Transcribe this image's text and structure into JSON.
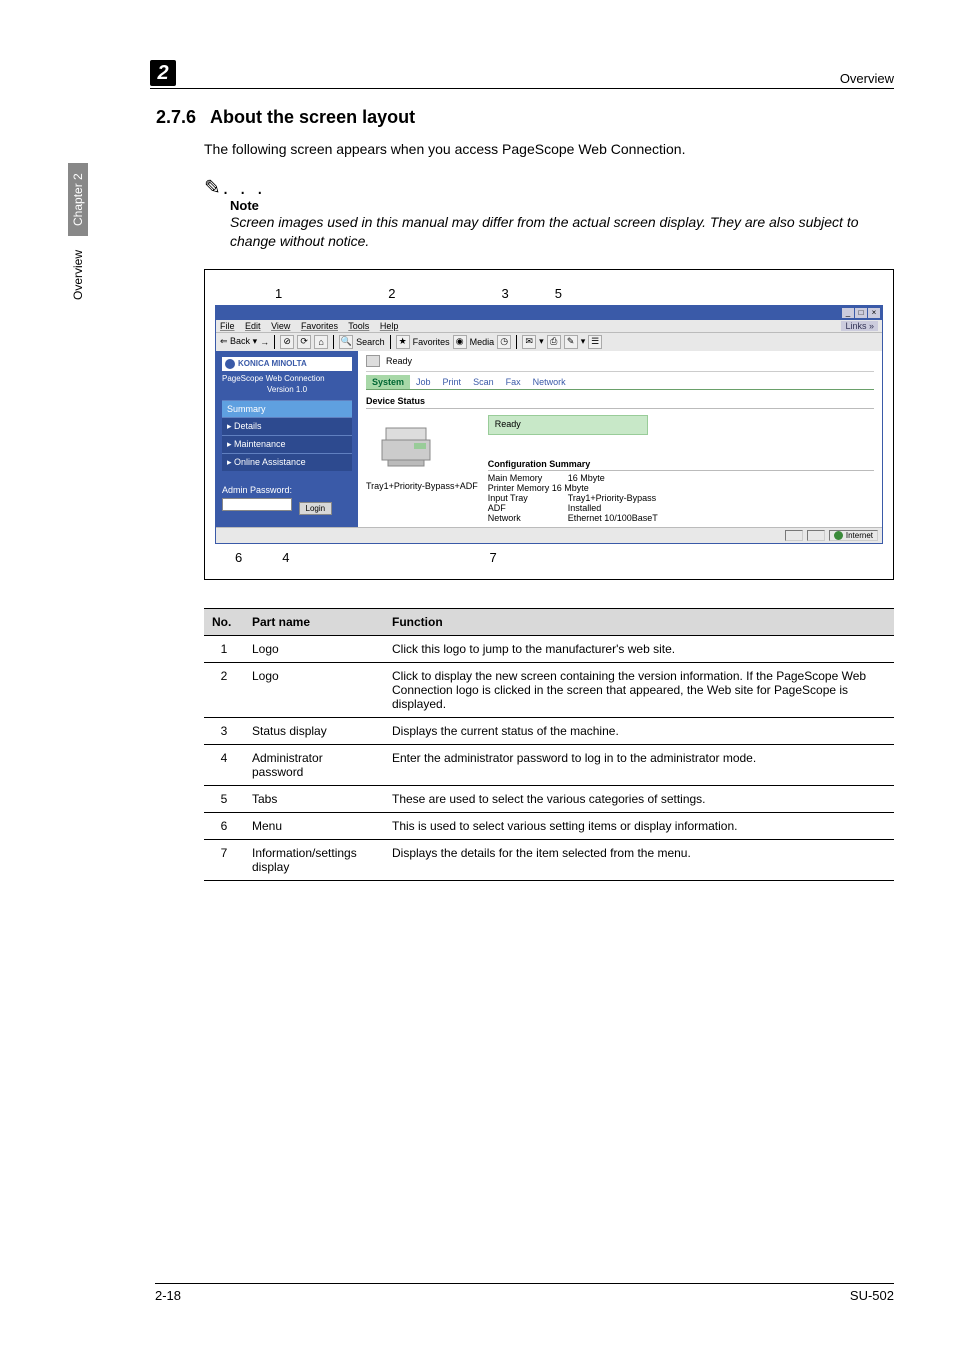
{
  "header": {
    "topic": "Overview",
    "chapter_badge": "2"
  },
  "side_tab": {
    "label": "Overview",
    "chapter": "Chapter 2"
  },
  "section": {
    "number": "2.7.6",
    "title": "About the screen layout"
  },
  "intro": "The following screen appears when you access PageScope Web Connection.",
  "note": {
    "icon": "✎",
    "dots": ". . .",
    "label": "Note",
    "text": "Screen images used in this manual may differ from the actual screen display. They are also subject to change without notice."
  },
  "figure": {
    "callouts_top": [
      "1",
      "2",
      "3",
      "5"
    ],
    "callouts_bottom": [
      "6",
      "4",
      "7"
    ],
    "browser": {
      "menu": {
        "file": "File",
        "edit": "Edit",
        "view": "View",
        "favorites": "Favorites",
        "tools": "Tools",
        "help": "Help",
        "links": "Links"
      },
      "toolbar": {
        "back": "Back",
        "search": "Search",
        "favorites": "Favorites",
        "media": "Media"
      },
      "left": {
        "brand": "KONICA MINOLTA",
        "pagescope": "PageScope Web Connection",
        "version": "Version 1.0",
        "nav": {
          "summary": "Summary",
          "details": "Details",
          "maintenance": "Maintenance",
          "online": "Online Assistance"
        },
        "admin_label": "Admin Password:",
        "login": "Login"
      },
      "right": {
        "ready": "Ready",
        "tabs": {
          "system": "System",
          "job": "Job",
          "print": "Print",
          "scan": "Scan",
          "fax": "Fax",
          "network": "Network"
        },
        "device_status": "Device Status",
        "ready_box": "Ready",
        "tray_text": "Tray1+Priority-Bypass+ADF",
        "cfg_title": "Configuration Summary",
        "cfg": {
          "main_mem_k": "Main Memory",
          "main_mem_v": "16 Mbyte",
          "prn_mem": "Printer Memory 16 Mbyte",
          "input_k": "Input Tray",
          "input_v": "Tray1+Priority-Bypass",
          "adf_k": "ADF",
          "adf_v": "Installed",
          "net_k": "Network",
          "net_v": "Ethernet 10/100BaseT"
        }
      },
      "status": {
        "internet": "Internet"
      }
    }
  },
  "table": {
    "headers": {
      "no": "No.",
      "part": "Part name",
      "func": "Function"
    },
    "rows": [
      {
        "no": "1",
        "part": "Logo",
        "func": "Click this logo to jump to the manufacturer's web site."
      },
      {
        "no": "2",
        "part": "Logo",
        "func": "Click to display the new screen containing the version information. If the PageScope Web Connection logo is clicked in the screen that appeared, the Web site for PageScope is displayed."
      },
      {
        "no": "3",
        "part": "Status display",
        "func": "Displays the current status of the machine."
      },
      {
        "no": "4",
        "part": "Administrator password",
        "func": "Enter the administrator password to log in to the administrator mode."
      },
      {
        "no": "5",
        "part": "Tabs",
        "func": "These are used to select the various categories of settings."
      },
      {
        "no": "6",
        "part": "Menu",
        "func": "This is used to select various setting items or display information."
      },
      {
        "no": "7",
        "part": "Information/settings display",
        "func": "Displays the details for the item selected from the menu."
      }
    ]
  },
  "footer": {
    "left": "2-18",
    "right": "SU-502"
  }
}
